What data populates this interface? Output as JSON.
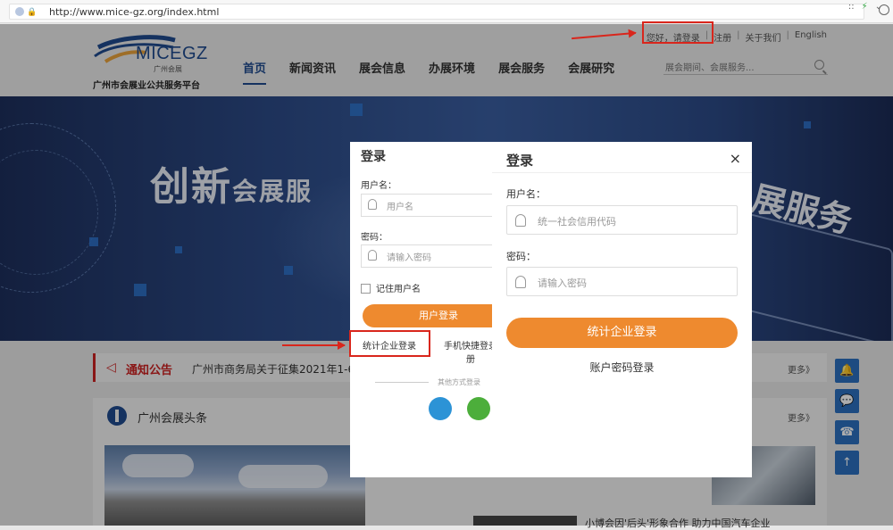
{
  "browser": {
    "url": "http://www.mice-gz.org/index.html",
    "tools": [
      "::",
      "⚡",
      "⌄"
    ]
  },
  "header": {
    "logo_name": "MICEGZ",
    "logo_sub": "广州会展",
    "logo_tagline": "广州市会展业公共服务平台",
    "top_links": [
      "您好，请登录",
      "|",
      "注册",
      "|",
      "关于我们",
      "|",
      "English"
    ],
    "nav": [
      "首页",
      "新闻资讯",
      "展会信息",
      "办展环境",
      "展会服务",
      "会展研究"
    ],
    "search_placeholder": "展会期间、会展服务..."
  },
  "banner": {
    "title_big": "创新",
    "title_small": "会展服",
    "title_right": "展服务"
  },
  "notice": {
    "icon": "◁",
    "label": "通知公告",
    "text": "广州市商务局关于征集2021年1-6",
    "more": "更多》"
  },
  "news": {
    "label": "广州会展头条",
    "more": "更多》",
    "line": "小博会因'后头'形象合作 助力中国汽车企业"
  },
  "side_buttons": [
    "🔔",
    "💬",
    "☎",
    "↑"
  ],
  "login_back": {
    "title": "登录",
    "username_label": "用户名：",
    "username_placeholder": "用户名",
    "password_label": "密码：",
    "password_placeholder": "请输入密码",
    "remember": "记住用户名",
    "button": "用户登录",
    "tab_company": "统计企业登录",
    "tab_phone": "手机快捷登录",
    "tab_phone_suffix": "册",
    "other_login": "其他方式登录"
  },
  "login_front": {
    "title": "登录",
    "close": "×",
    "username_label": "用户名：",
    "username_placeholder": "统一社会信用代码",
    "password_label": "密码：",
    "password_placeholder": "请输入密码",
    "button": "统计企业登录",
    "alt_login": "账户密码登录"
  },
  "colors": {
    "brand_blue": "#1f4b8e",
    "accent_orange": "#ee8a2f",
    "annotation_red": "#d9261c"
  }
}
